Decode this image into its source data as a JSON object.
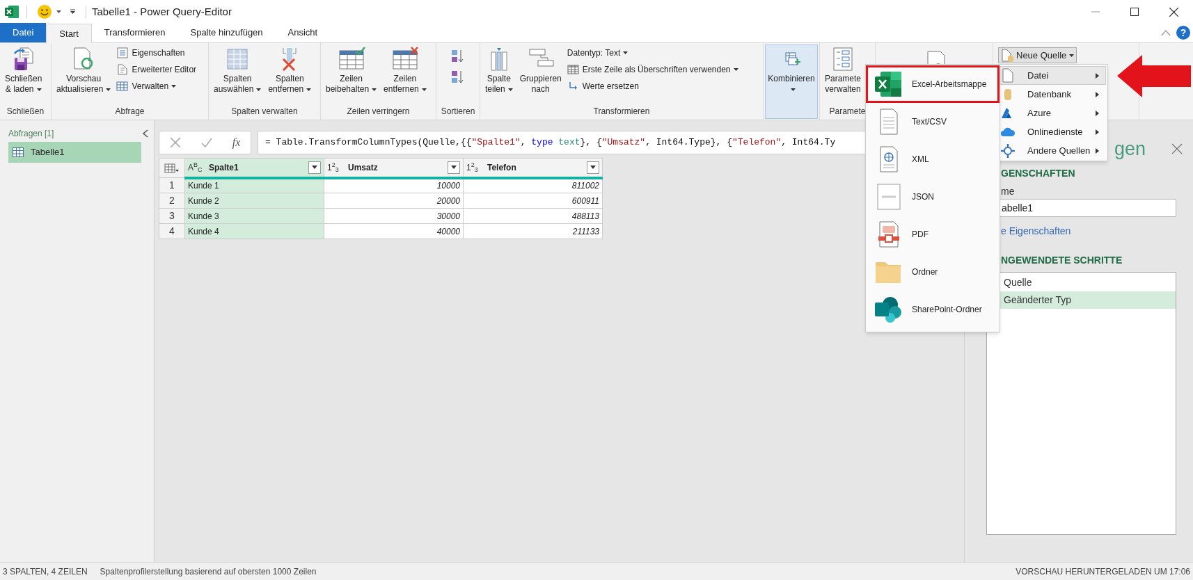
{
  "window": {
    "title": "Tabelle1 - Power Query-Editor"
  },
  "tabs": [
    {
      "label": "Datei",
      "kind": "file",
      "selected": false
    },
    {
      "label": "Start",
      "kind": "tab",
      "selected": true
    },
    {
      "label": "Transformieren",
      "kind": "tab",
      "selected": false
    },
    {
      "label": "Spalte hinzufügen",
      "kind": "tab",
      "selected": false
    },
    {
      "label": "Ansicht",
      "kind": "tab",
      "selected": false
    }
  ],
  "help": "?",
  "ribbon": [
    {
      "label": "Schließen",
      "items": [
        {
          "kind": "large",
          "lines": [
            "Schließen",
            "& laden"
          ],
          "dropdown": true,
          "pressed": false
        }
      ]
    },
    {
      "label": "Abfrage",
      "items": [
        {
          "kind": "large",
          "lines": [
            "Vorschau",
            "aktualisieren"
          ],
          "dropdown": true,
          "pressed": false
        },
        {
          "kind": "stack",
          "items": [
            {
              "label": "Eigenschaften",
              "dropdown": false
            },
            {
              "label": "Erweiterter Editor",
              "dropdown": false
            },
            {
              "label": "Verwalten",
              "dropdown": true
            }
          ]
        }
      ]
    },
    {
      "label": "Spalten verwalten",
      "items": [
        {
          "kind": "large",
          "lines": [
            "Spalten",
            "auswählen"
          ],
          "dropdown": true,
          "pressed": false
        },
        {
          "kind": "large",
          "lines": [
            "Spalten",
            "entfernen"
          ],
          "dropdown": true,
          "pressed": false
        }
      ]
    },
    {
      "label": "Zeilen verringern",
      "items": [
        {
          "kind": "large",
          "lines": [
            "Zeilen",
            "beibehalten"
          ],
          "dropdown": true,
          "pressed": false
        },
        {
          "kind": "large",
          "lines": [
            "Zeilen",
            "entfernen"
          ],
          "dropdown": true,
          "pressed": false
        }
      ]
    },
    {
      "label": "Sortieren",
      "items": [
        {
          "kind": "sort"
        }
      ]
    },
    {
      "label": "Transformieren",
      "items": [
        {
          "kind": "large",
          "lines": [
            "Spalte",
            "teilen"
          ],
          "dropdown": true,
          "pressed": false
        },
        {
          "kind": "large",
          "lines": [
            "Gruppieren",
            "nach"
          ],
          "dropdown": false,
          "pressed": false
        },
        {
          "kind": "stack",
          "items": [
            {
              "label": "Datentyp: Text",
              "dropdown": true
            },
            {
              "label": "Erste Zeile als Überschriften verwenden",
              "dropdown": true
            },
            {
              "label": "Werte ersetzen",
              "dropdown": false
            }
          ]
        }
      ]
    },
    {
      "items": [
        {
          "kind": "large",
          "lines": [
            "Kombinieren"
          ],
          "dropdown": true,
          "pressed": true
        }
      ]
    },
    {
      "label": "Paramete",
      "items": [
        {
          "kind": "large",
          "lines": [
            "Paramete",
            "verwalten"
          ],
          "dropdown": false,
          "pressed": false
        }
      ]
    },
    {
      "items": [
        {
          "kind": "icon"
        }
      ]
    },
    {
      "items": [
        {
          "kind": "small",
          "label": "Neue Quelle",
          "dropdown": true,
          "pressed": true
        }
      ]
    }
  ],
  "source_menu": {
    "items": [
      {
        "label": "Datei",
        "selected": true
      },
      {
        "label": "Datenbank",
        "selected": false
      },
      {
        "label": "Azure",
        "selected": false
      },
      {
        "label": "Onlinedienste",
        "selected": false
      },
      {
        "label": "Andere Quellen",
        "selected": false
      }
    ]
  },
  "file_menu": {
    "items": [
      {
        "label": "Excel-Arbeitsmappe",
        "selected": true
      },
      {
        "label": "Text/CSV",
        "selected": false
      },
      {
        "label": "XML",
        "selected": false
      },
      {
        "label": "JSON",
        "selected": false
      },
      {
        "label": "PDF",
        "selected": false
      },
      {
        "label": "Ordner",
        "selected": false
      },
      {
        "label": "SharePoint-Ordner",
        "selected": false
      }
    ]
  },
  "queries": {
    "header": "Abfragen [1]",
    "items": [
      {
        "label": "Tabelle1",
        "selected": true
      }
    ]
  },
  "formula_bar": {
    "fx": "fx",
    "segments": [
      {
        "kind": "plain",
        "text": "= Table.TransformColumnTypes(Quelle,{{"
      },
      {
        "kind": "string",
        "text": "\"Spalte1\""
      },
      {
        "kind": "plain",
        "text": ", "
      },
      {
        "kind": "keyword",
        "text": "type"
      },
      {
        "kind": "type",
        "text": " text"
      },
      {
        "kind": "plain",
        "text": "}, {"
      },
      {
        "kind": "string",
        "text": "\"Umsatz\""
      },
      {
        "kind": "plain",
        "text": ", Int64.Type}, {"
      },
      {
        "kind": "string",
        "text": "\"Telefon\""
      },
      {
        "kind": "plain",
        "text": ", Int64.Ty"
      }
    ]
  },
  "table": {
    "columns": [
      {
        "type": "A$^{B}$$_{C}$",
        "name": "Spalte1",
        "selected": true
      },
      {
        "type": "1$^{2}$$_{3}$",
        "name": "Umsatz",
        "selected": false
      },
      {
        "type": "1$^{2}$$_{3}$",
        "name": "Telefon",
        "selected": false
      }
    ],
    "rows": [
      {
        "number": "1",
        "cells": [
          "Kunde 1",
          "10000",
          "811002"
        ]
      },
      {
        "number": "2",
        "cells": [
          "Kunde 2",
          "20000",
          "600911"
        ]
      },
      {
        "number": "3",
        "cells": [
          "Kunde 3",
          "30000",
          "488113"
        ]
      },
      {
        "number": "4",
        "cells": [
          "Kunde 4",
          "40000",
          "211133"
        ]
      }
    ]
  },
  "settings": {
    "title": "gen",
    "properties_heading": "GENSCHAFTEN",
    "name_label": "me",
    "name_value": "abelle1",
    "properties_link": "e Eigenschaften",
    "steps_heading": "NGEWENDETE SCHRITTE",
    "steps": [
      {
        "label": "Quelle",
        "selected": false
      },
      {
        "label": "Geänderter Typ",
        "selected": true
      }
    ]
  },
  "status_bar": {
    "left": [
      "3 SPALTEN, 4 ZEILEN",
      "Spaltenprofilerstellung basierend auf obersten 1000 Zeilen"
    ],
    "right": "VORSCHAU HERUNTERGELADEN UM 17:06"
  }
}
